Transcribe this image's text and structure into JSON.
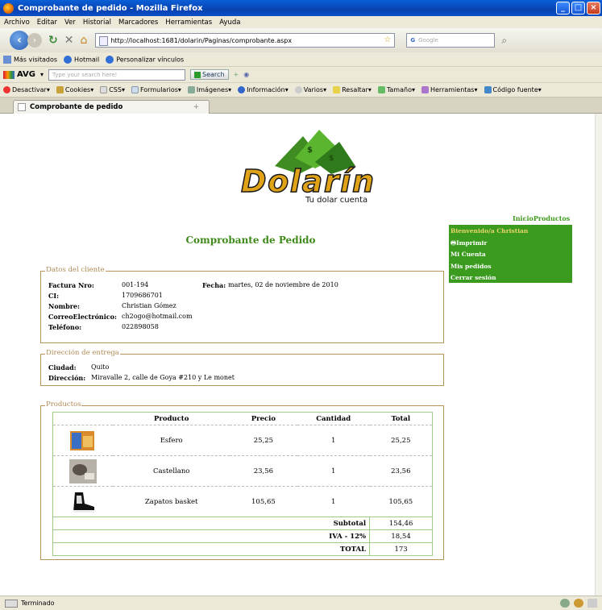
{
  "window": {
    "title": "Comprobante de pedido - Mozilla Firefox"
  },
  "menu": [
    "Archivo",
    "Editar",
    "Ver",
    "Historial",
    "Marcadores",
    "Herramientas",
    "Ayuda"
  ],
  "nav": {
    "url": "http://localhost:1681/dolarin/Paginas/comprobante.aspx",
    "search_placeholder": "Google"
  },
  "bookmarks": [
    "Más visitados",
    "Hotmail",
    "Personalizar vínculos"
  ],
  "avg": {
    "label": "AVG",
    "search_placeholder": "Type your search here!",
    "search_button": "Search"
  },
  "devbar": [
    "Desactivar",
    "Cookies",
    "CSS",
    "Formularios",
    "Imágenes",
    "Información",
    "Varios",
    "Resaltar",
    "Tamaño",
    "Herramientas",
    "Código fuente"
  ],
  "tab": {
    "title": "Comprobante de pedido"
  },
  "logo": {
    "brand": "Dolarín",
    "tagline": "Tu dolar cuenta"
  },
  "top_links": {
    "inicio": "Inicio",
    "productos": "Productos"
  },
  "user_menu": {
    "welcome": "Bienvenido/a Christian",
    "items": [
      "Imprimir",
      "Mi Cuenta",
      "Mis pedidos",
      "Cerrar sesión"
    ]
  },
  "page_title": "Comprobante de Pedido",
  "cliente": {
    "legend": "Datos del cliente",
    "factura_label": "Factura Nro:",
    "factura": "001-194",
    "fecha_label": "Fecha:",
    "fecha": "martes, 02 de noviembre de 2010",
    "ci_label": "CI:",
    "ci": "1709686701",
    "nombre_label": "Nombre:",
    "nombre": "Christian Gómez",
    "correo_label": "CorreoElectrónico:",
    "correo": "ch2ogo@hotmail.com",
    "telefono_label": "Teléfono:",
    "telefono": "022898058"
  },
  "entrega": {
    "legend": "Dirección de entrega",
    "ciudad_label": "Ciudad:",
    "ciudad": "Quito",
    "direccion_label": "Dirección:",
    "direccion": "Miravalle 2, calle de Goya #210 y Le monet"
  },
  "productos": {
    "legend": "Productos",
    "headers": [
      "Producto",
      "Precio",
      "Cantidad",
      "Total"
    ],
    "items": [
      {
        "producto": "Esfero",
        "precio": "25,25",
        "cantidad": "1",
        "total": "25,25"
      },
      {
        "producto": "Castellano",
        "precio": "23,56",
        "cantidad": "1",
        "total": "23,56"
      },
      {
        "producto": "Zapatos basket",
        "precio": "105,65",
        "cantidad": "1",
        "total": "105,65"
      }
    ],
    "subtotal_label": "Subtotal",
    "subtotal": "154,46",
    "iva_label": "IVA - 12%",
    "iva": "18,54",
    "total_label": "TOTAL",
    "total": "173"
  },
  "status": {
    "text": "Terminado"
  }
}
